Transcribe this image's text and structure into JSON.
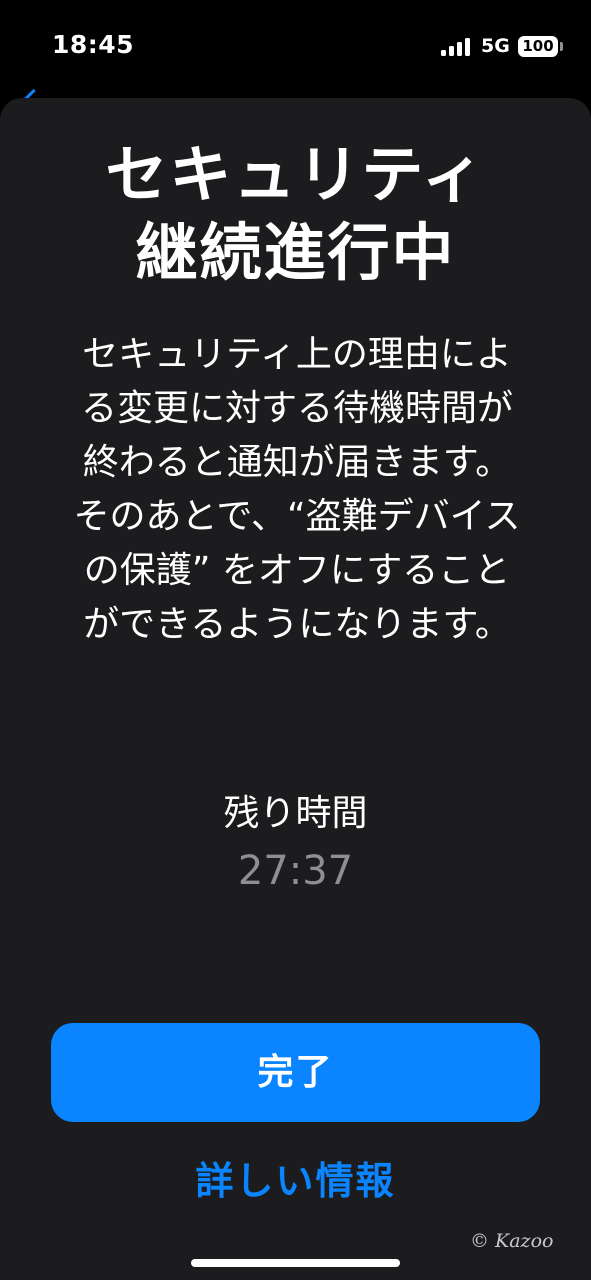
{
  "status_bar": {
    "time": "18:45",
    "network": "5G",
    "battery": "100",
    "signal_icon": "cellular-signal-icon",
    "battery_icon": "battery-icon"
  },
  "sheet": {
    "title_line1": "セキュリティ",
    "title_line2": "継続進行中",
    "description": "セキュリティ上の理由による変更に対する待機時間が終わると通知が届きます。そのあとで、“盗難デバイスの保護” をオフにすることができるようになります。",
    "remaining_label": "残り時間",
    "remaining_time": "27:37",
    "done_label": "完了",
    "more_info_label": "詳しい情報"
  },
  "watermark": "© Kazoo",
  "colors": {
    "accent": "#0a84ff",
    "sheet_background": "#1c1c1e",
    "secondary_text": "#8e8e93"
  }
}
